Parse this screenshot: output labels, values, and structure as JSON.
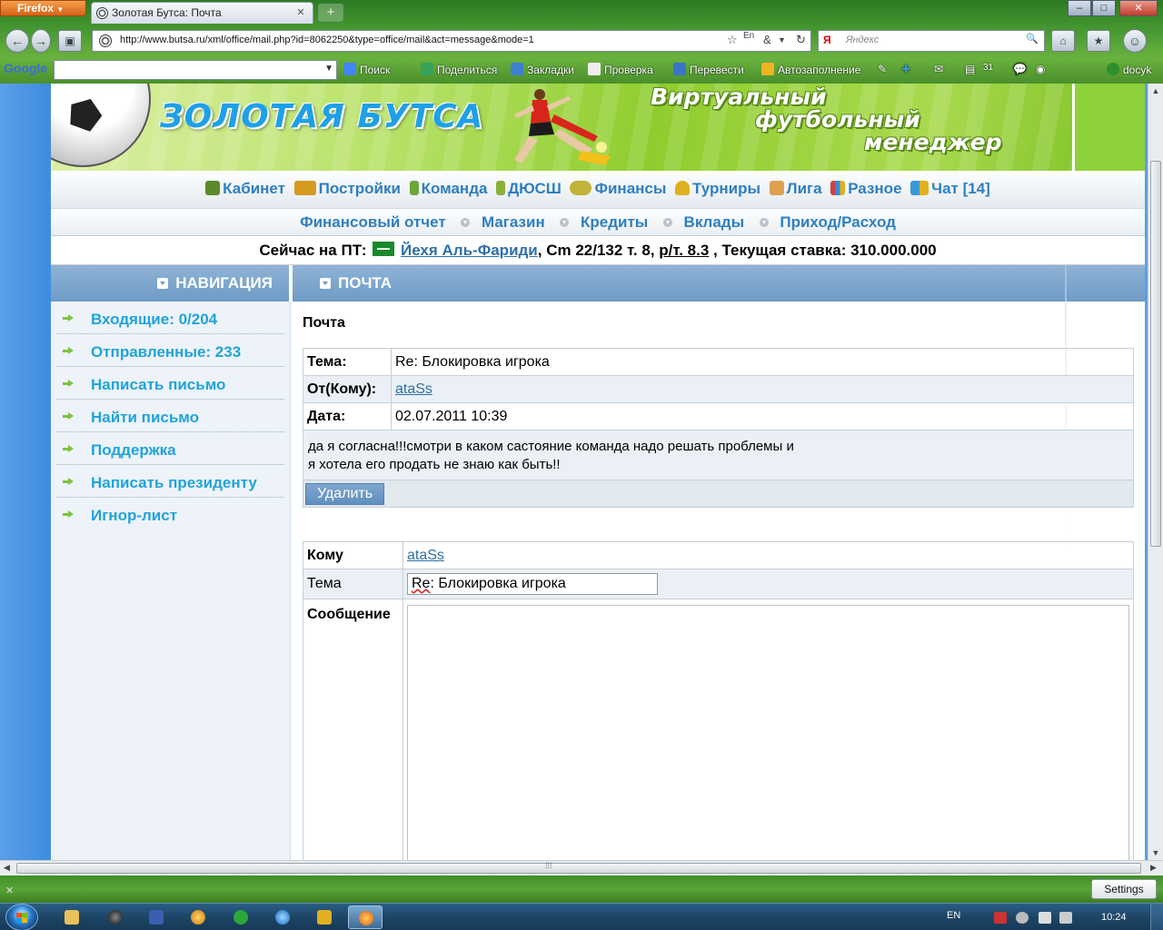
{
  "browser": {
    "app_button": "Firefox",
    "tab_title": "Золотая Бутса: Почта",
    "url": "http://www.butsa.ru/xml/office/mail.php?id=8062250&type=office/mail&act=message&mode=1",
    "search_placeholder": "Яндекс",
    "search_engine_glyph": "Я"
  },
  "google_toolbar": {
    "logo": "Google",
    "items": [
      {
        "label": "Поиск",
        "icon": "google-g-icon",
        "color": "#4285f4"
      },
      {
        "label": "Поделиться",
        "icon": "share-icon",
        "color": "#35a35a"
      },
      {
        "label": "Закладки",
        "icon": "star-icon",
        "color": "#3f7fd0"
      },
      {
        "label": "Проверка",
        "icon": "spellcheck-icon",
        "color": "#eeeeee"
      },
      {
        "label": "Перевести",
        "icon": "translate-icon",
        "color": "#3a76c8"
      },
      {
        "label": "Автозаполнение",
        "icon": "autofill-icon",
        "color": "#f0b420"
      }
    ],
    "user": "docyk"
  },
  "site": {
    "title": "ЗОЛОТАЯ БУТСА",
    "tagline": [
      "Виртуальный",
      "футбольный",
      "менеджер"
    ]
  },
  "main_nav": [
    {
      "label": "Кабинет",
      "icon": "pencil-icon",
      "color": "#5a8a2a"
    },
    {
      "label": "Постройки",
      "icon": "people-icon",
      "color": "#d69a20"
    },
    {
      "label": "Команда",
      "icon": "player-icon",
      "color": "#6aa83a"
    },
    {
      "label": "ДЮСШ",
      "icon": "youth-icon",
      "color": "#8ab03a"
    },
    {
      "label": "Финансы",
      "icon": "money-icon",
      "color": "#c2b23a"
    },
    {
      "label": "Турниры",
      "icon": "trophy-icon",
      "color": "#e0b020"
    },
    {
      "label": "Лига",
      "icon": "league-icon",
      "color": "#e0a050"
    },
    {
      "label": "Разное",
      "icon": "chart-icon",
      "color": "#d04040"
    },
    {
      "label": "Чат [14]",
      "icon": "chat-icon",
      "color": "#3a9ad8"
    }
  ],
  "sub_nav": [
    "Финансовый отчет",
    "Магазин",
    "Кредиты",
    "Вклады",
    "Приход/Расход"
  ],
  "now_line": {
    "prefix": "Сейчас на ПТ:",
    "player": "Йехя Аль-Фариди",
    "details": ", Cm 22/132 т. 8,",
    "rating": "р/т. 8.3",
    "bid": ", Текущая ставка: 310.000.000"
  },
  "sections": {
    "navigation": "НАВИГАЦИЯ",
    "mail": "ПОЧТА"
  },
  "left_nav": [
    "Входящие: 0/204",
    "Отправленные: 233",
    "Написать письмо",
    "Найти письмо",
    "Поддержка",
    "Написать президенту",
    "Игнор-лист"
  ],
  "content": {
    "heading": "Почта",
    "message": {
      "subject_label": "Тема:",
      "subject": "Re: Блокировка игрока",
      "from_label": "От(Кому):",
      "from": "ataSs",
      "date_label": "Дата:",
      "date": "02.07.2011 10:39",
      "body_line1": "да я согласна!!!смотри в каком састояние команда надо решать проблемы и",
      "body_line2": "я хотела его продать не знаю как быть!!",
      "delete_button": "Удалить"
    },
    "reply": {
      "to_label": "Кому",
      "to": "ataSs",
      "subject_label": "Тема",
      "subject_prefix": "Re",
      "subject_rest": ": Блокировка игрока",
      "message_label": "Сообщение"
    }
  },
  "statusbar": {
    "settings_button": "Settings"
  },
  "taskbar": {
    "lang": "EN",
    "time": "10:24"
  }
}
